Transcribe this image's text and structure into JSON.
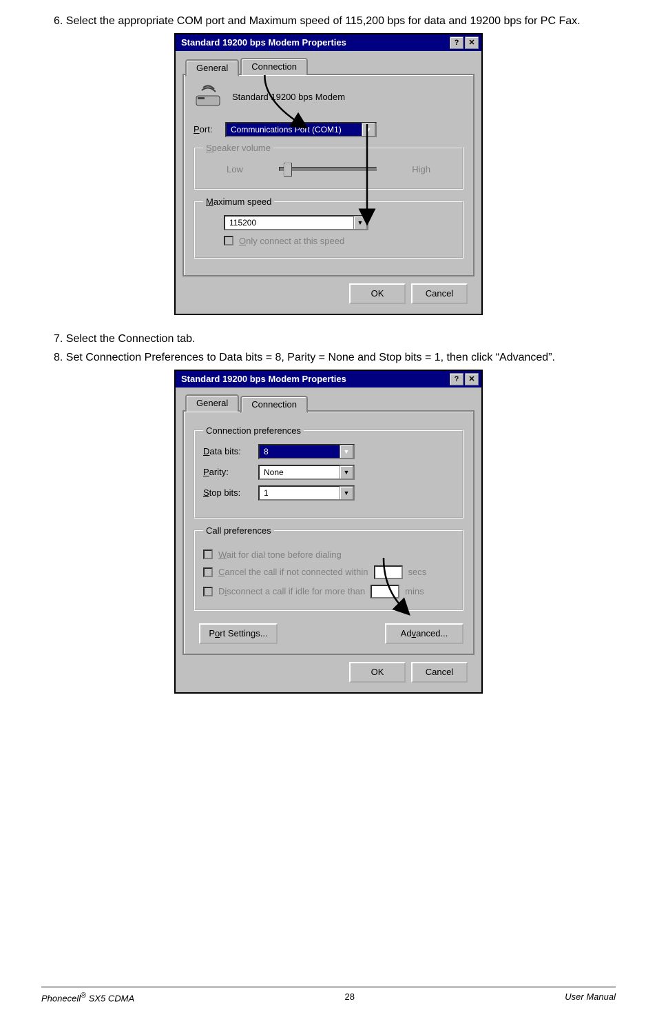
{
  "instructions": {
    "i6": "6. Select the appropriate COM port and Maximum speed of 115,200 bps for data and 19200 bps for PC Fax.",
    "i7": "7. Select the Connection tab.",
    "i8": "8. Set Connection Preferences to Data bits = 8, Parity = None and Stop bits = 1, then click “Advanced”."
  },
  "dialog1": {
    "title": "Standard 19200 bps Modem Properties",
    "help_btn": "?",
    "close_btn": "✕",
    "tab_general": "General",
    "tab_connection": "Connection",
    "modem_name": "Standard 19200 bps Modem",
    "port_label": "Port:",
    "port_value": "Communications Port (COM1)",
    "speaker_legend": "Speaker volume",
    "low": "Low",
    "high": "High",
    "maxspeed_legend": "Maximum speed",
    "maxspeed_value": "115200",
    "only_connect": "Only connect at this speed",
    "ok": "OK",
    "cancel": "Cancel"
  },
  "dialog2": {
    "title": "Standard 19200 bps Modem Properties",
    "help_btn": "?",
    "close_btn": "✕",
    "tab_general": "General",
    "tab_connection": "Connection",
    "conn_prefs_legend": "Connection preferences",
    "data_bits_label": "Data bits:",
    "data_bits_value": "8",
    "parity_label": "Parity:",
    "parity_value": "None",
    "stop_bits_label": "Stop bits:",
    "stop_bits_value": "1",
    "call_prefs_legend": "Call preferences",
    "wait_dial": "Wait for dial tone before dialing",
    "cancel_call": "Cancel the call if not connected within",
    "secs": "secs",
    "disconnect_idle": "Disconnect a call if idle for more than",
    "mins": "mins",
    "port_settings": "Port Settings...",
    "advanced": "Advanced...",
    "ok": "OK",
    "cancel": "Cancel"
  },
  "footer": {
    "left_product": "Phonecell",
    "left_reg": "®",
    "left_model": " SX5 CDMA",
    "page": "28",
    "right": "User Manual"
  }
}
